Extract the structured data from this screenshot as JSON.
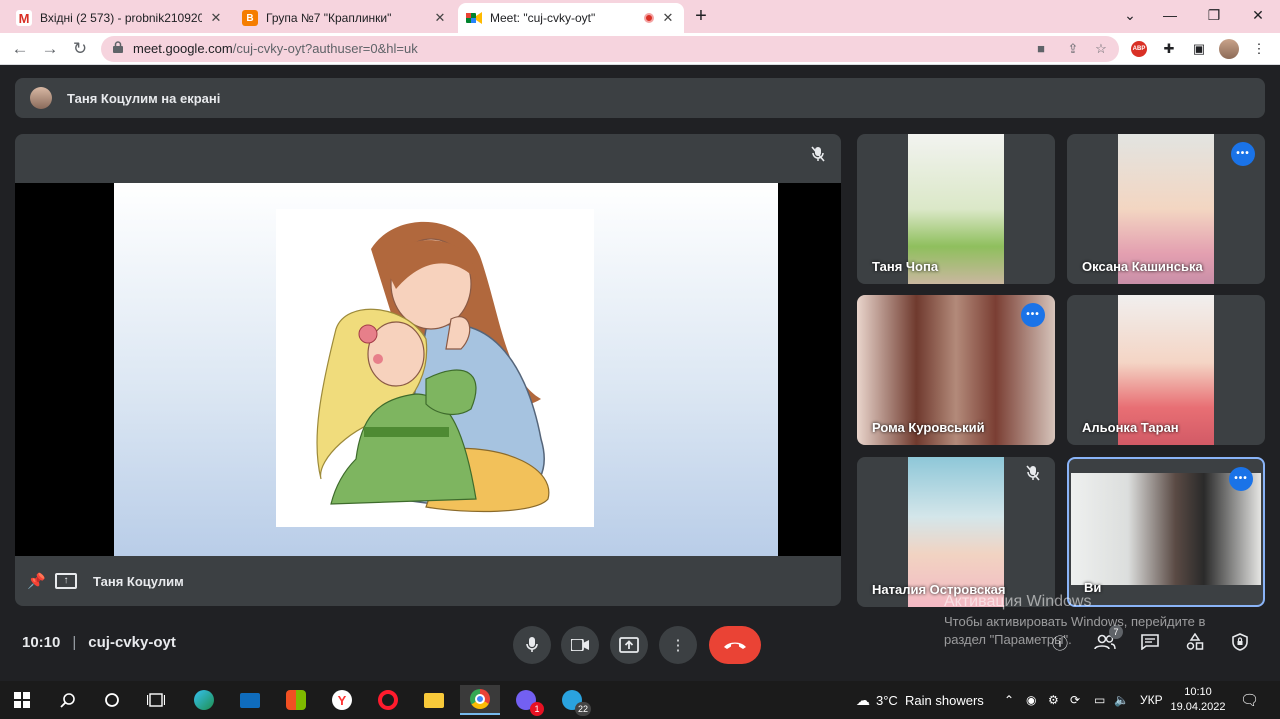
{
  "tabs": [
    {
      "title": "Вхідні (2 573) - probnik21092018",
      "icon": "gmail-icon"
    },
    {
      "title": "Група №7 \"Краплинки\"",
      "icon": "blogger-icon"
    },
    {
      "title": "Meet: \"cuj-cvky-oyt\"",
      "icon": "meet-icon"
    }
  ],
  "browser": {
    "url_host": "meet.google.com",
    "url_path": "/cuj-cvky-oyt?authuser=0&hl=uk"
  },
  "meet": {
    "presenting_banner": "Таня Коцулим на екрані",
    "presenter_name": "Таня Коцулим",
    "participants": [
      {
        "name": "Таня Чопа",
        "status": "none"
      },
      {
        "name": "Оксана Кашинська",
        "status": "speaking"
      },
      {
        "name": "Рома Куровський",
        "status": "speaking"
      },
      {
        "name": "Альонка Таран",
        "status": "none"
      },
      {
        "name": "Наталия Островская",
        "status": "muted"
      },
      {
        "name": "Ви",
        "status": "speaking"
      }
    ],
    "time": "10:10",
    "meeting_code": "cuj-cvky-oyt",
    "participants_count": "7"
  },
  "watermark": {
    "line1": "Активация Windows",
    "line2": "Чтобы активировать Windows, перейдите в",
    "line3": "раздел \"Параметры\"."
  },
  "taskbar": {
    "weather": "3°C  Rain showers",
    "lang": "УКР",
    "time": "10:10",
    "date": "19.04.2022",
    "viber_badge": "1",
    "telegram_badge": "22"
  },
  "colors": {
    "accent": "#1a73e8",
    "end_call": "#ea4335",
    "tab_strip": "#f6d4de",
    "meet_bg": "#202124"
  }
}
